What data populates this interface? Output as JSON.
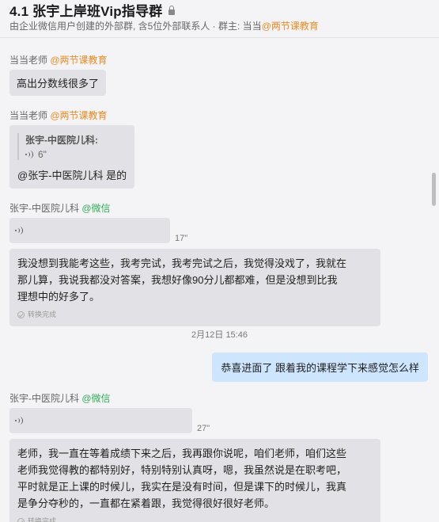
{
  "header": {
    "title": "4.1 张宇上岸班Vip指导群",
    "subtitle_prefix": "由企业微信用户创建的外部群, 含5位外部联系人 · 群主: 当当",
    "subtitle_org": "@两节课教育"
  },
  "messages": [
    {
      "sender": "当当老师",
      "org": "@两节课教育",
      "text": "高出分数线很多了"
    },
    {
      "sender": "当当老师",
      "org": "@两节课教育",
      "quote_name": "张宇-中医院儿科:",
      "quote_voice": "6\"",
      "text": "@张宇-中医院儿科  是的"
    },
    {
      "sender": "张宇-中医院儿科",
      "org": "@微信",
      "voice_duration": "17\"",
      "transcript_lines": [
        "我没想到我能考这些，我考完试，我考完试之后，我觉得没戏了，我就在",
        "那儿算，我说我都没对答案，我想好像90分儿都都难，但是没想到比我",
        "理想中的好多了。"
      ],
      "convert_label": "转换完成"
    },
    {
      "timestamp": "2月12日 15:46"
    },
    {
      "mine": true,
      "text": "恭喜进面了   跟着我的课程学下来感觉怎么样"
    },
    {
      "sender": "张宇-中医院儿科",
      "org": "@微信",
      "voice_duration": "27\"",
      "transcript_lines": [
        "老师，我一直在等着成绩下来之后，我再跟你说呢，咱们老师，咱们这些",
        "老师我觉得教的都特别好，特别特别认真呀，嗯，我虽然说是在职考吧，",
        "平时就是正上课的时候儿，我实在是没有时间，但是课下的时候儿，我真",
        "是争分夺秒的，一直都在紧着跟，我觉得很好很好老师。"
      ],
      "convert_label": "转换完成"
    }
  ],
  "colors": {
    "org_accent": "#f08a24",
    "wechat_green": "#2fae55",
    "bubble_gray": "#e2e2e6",
    "bubble_mine": "#cde5fd"
  }
}
